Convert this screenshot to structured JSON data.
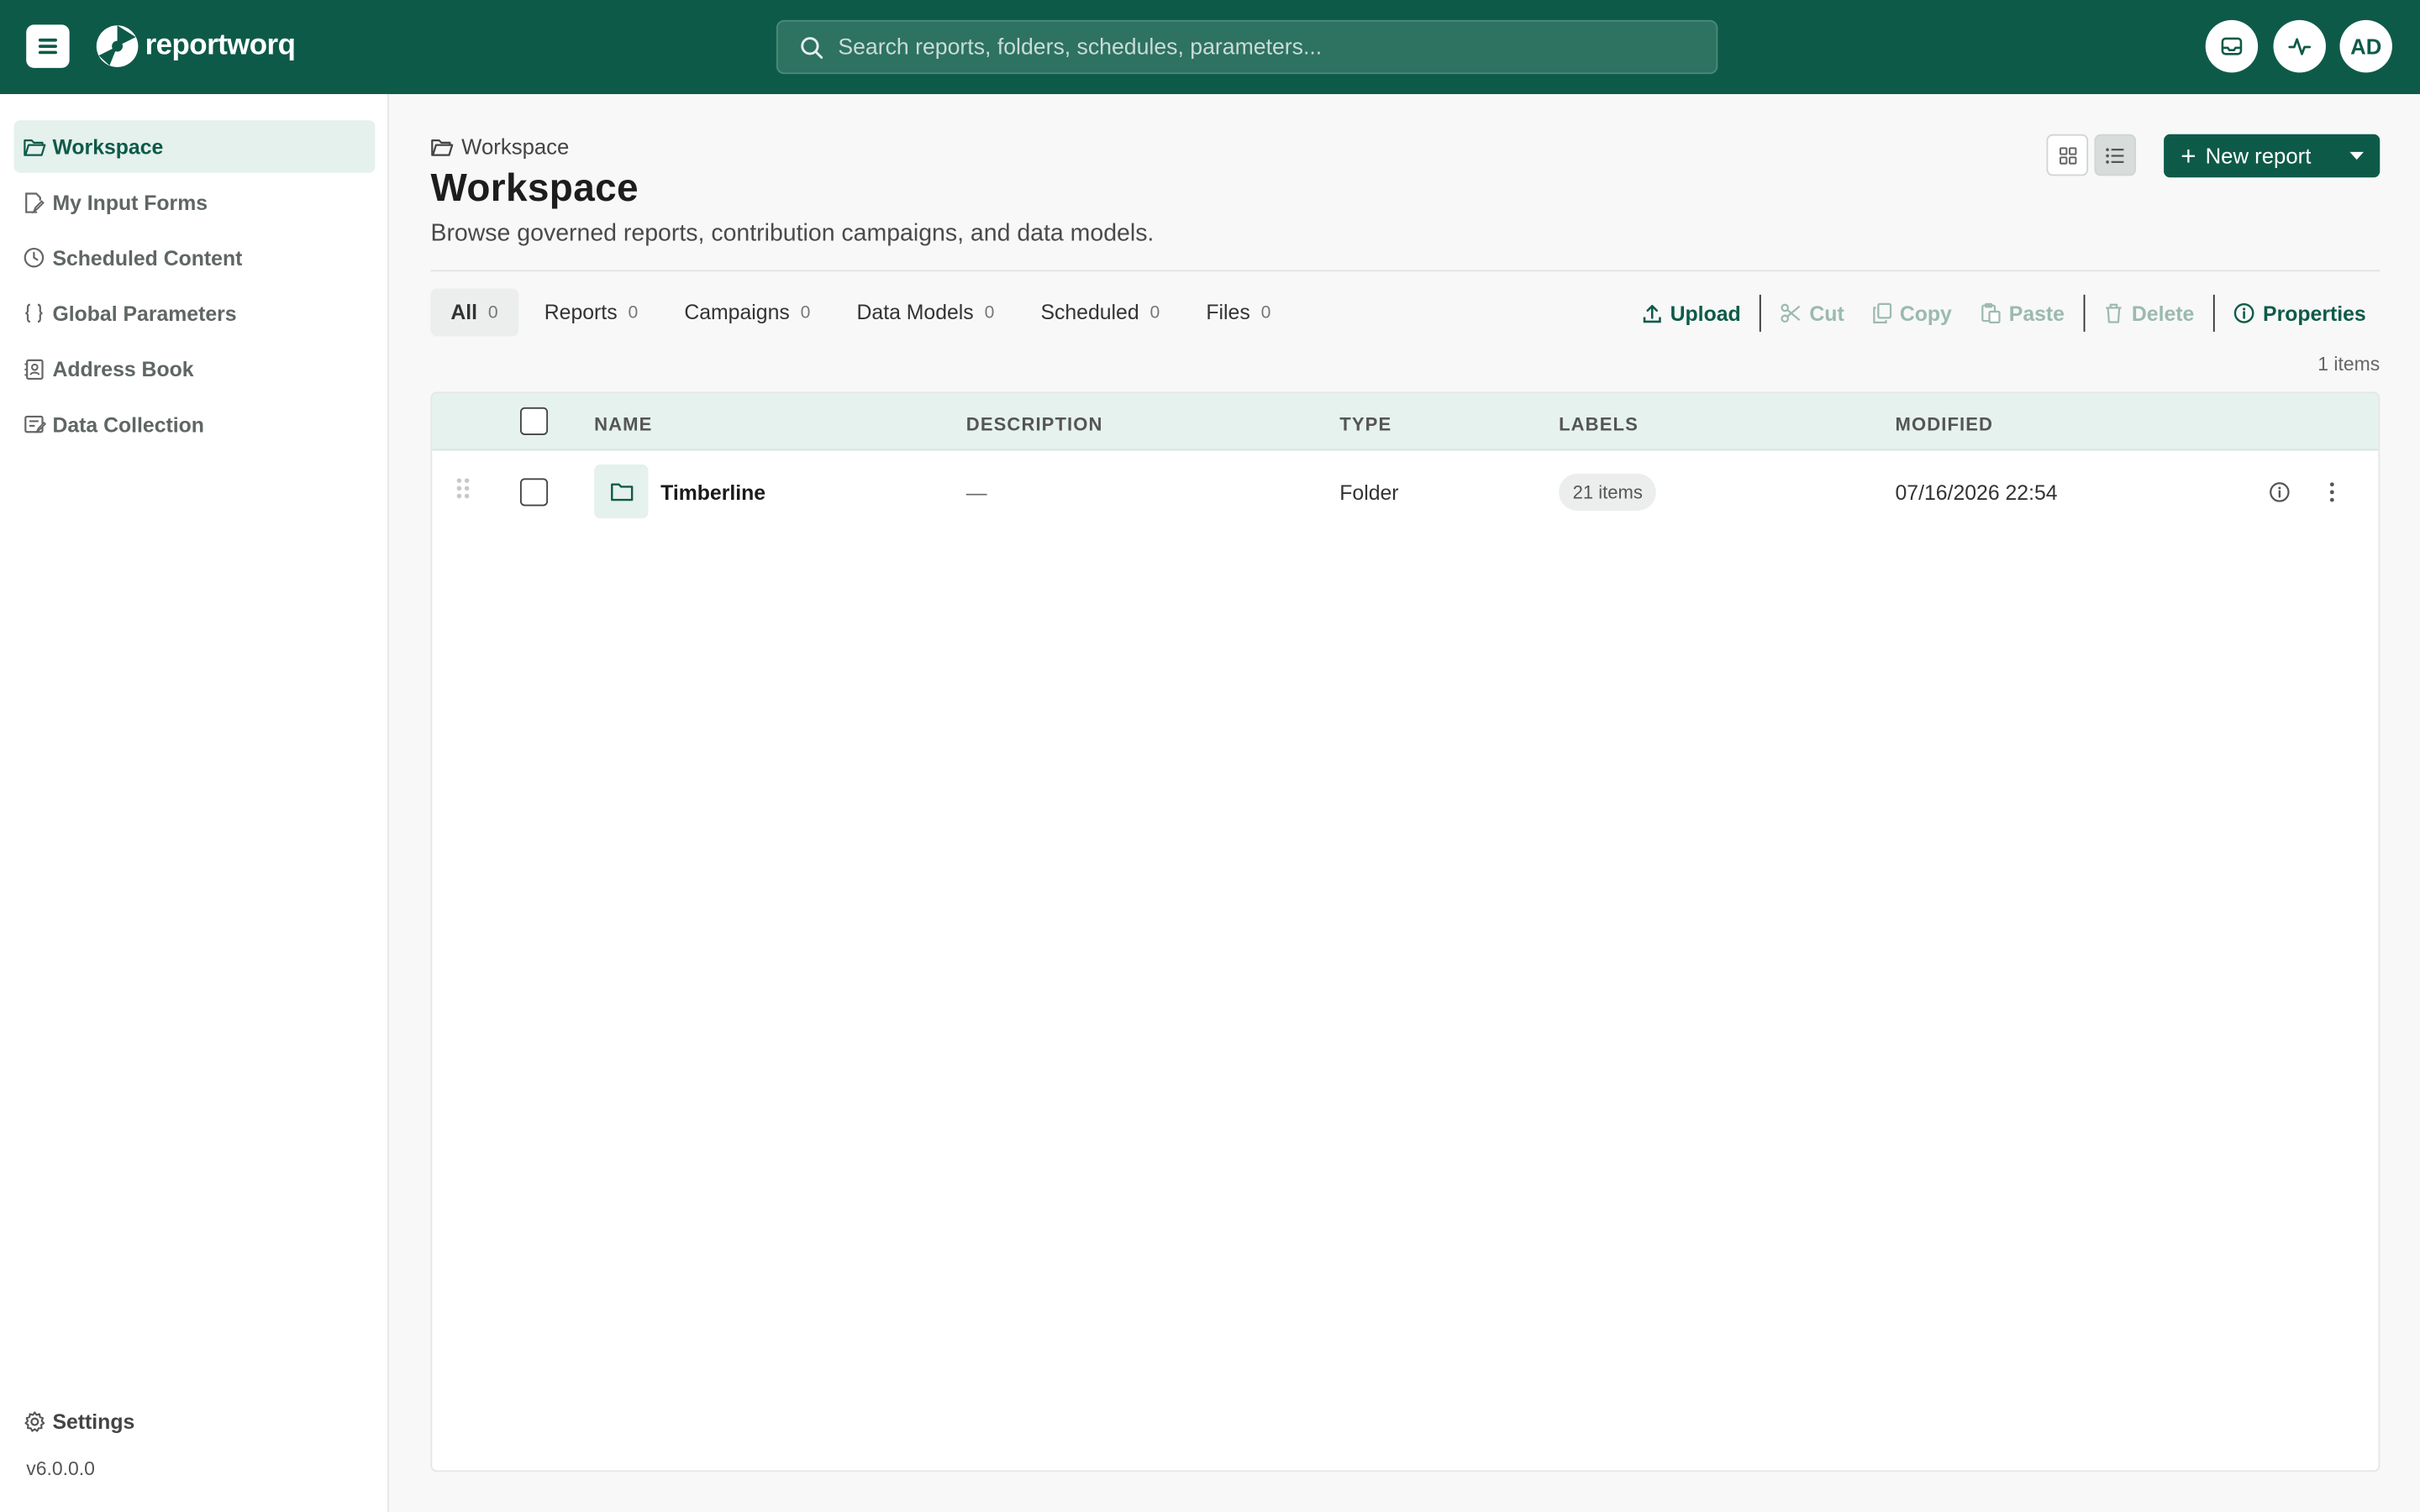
{
  "app": {
    "brand": "reportworq",
    "search_placeholder": "Search reports, folders, schedules, parameters...",
    "avatar_initials": "AD",
    "brand_color": "#0e5a49"
  },
  "sidebar": {
    "items": [
      {
        "label": "Workspace",
        "icon": "folder-open-icon",
        "active": true
      },
      {
        "label": "My Input Forms",
        "icon": "edit-document-icon",
        "active": false
      },
      {
        "label": "Scheduled Content",
        "icon": "clock-icon",
        "active": false
      },
      {
        "label": "Global Parameters",
        "icon": "braces-icon",
        "active": false
      },
      {
        "label": "Address Book",
        "icon": "contact-book-icon",
        "active": false
      },
      {
        "label": "Data Collection",
        "icon": "form-icon",
        "active": false
      }
    ],
    "settings_label": "Settings",
    "version": "v6.0.0.0"
  },
  "main": {
    "breadcrumb": "Workspace",
    "title": "Workspace",
    "subtitle": "Browse governed reports, contribution campaigns, and data models.",
    "new_report_label": "New report",
    "tabs": [
      {
        "label": "All",
        "count": "0",
        "active": true
      },
      {
        "label": "Reports",
        "count": "0",
        "active": false
      },
      {
        "label": "Campaigns",
        "count": "0",
        "active": false
      },
      {
        "label": "Data Models",
        "count": "0",
        "active": false
      },
      {
        "label": "Scheduled",
        "count": "0",
        "active": false
      },
      {
        "label": "Files",
        "count": "0",
        "active": false
      }
    ],
    "toolbar": {
      "upload": "Upload",
      "cut": "Cut",
      "copy": "Copy",
      "paste": "Paste",
      "delete": "Delete",
      "properties": "Properties"
    },
    "items_count": "1 items",
    "table": {
      "columns": [
        "NAME",
        "DESCRIPTION",
        "TYPE",
        "LABELS",
        "MODIFIED"
      ],
      "rows": [
        {
          "name": "Timberline",
          "description": "—",
          "type": "Folder",
          "labels": "21 items",
          "modified": "07/16/2026 22:54"
        }
      ]
    }
  }
}
